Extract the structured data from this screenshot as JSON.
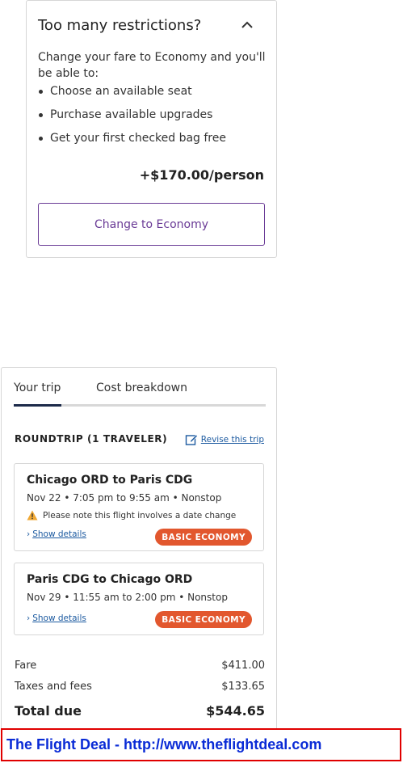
{
  "restrictions": {
    "title": "Too many restrictions?",
    "description": "Change your fare to Economy and you'll be able to:",
    "benefits": [
      "Choose an available seat",
      "Purchase available upgrades",
      "Get your first checked bag free"
    ],
    "price": "+$170.00/person",
    "button_label": "Change to Economy"
  },
  "trip": {
    "tabs": [
      {
        "label": "Your trip",
        "active": true
      },
      {
        "label": "Cost breakdown",
        "active": false
      }
    ],
    "roundtrip_label": "ROUNDTRIP (1 TRAVELER)",
    "revise_label": "Revise this trip",
    "segments": [
      {
        "route": "Chicago ORD to Paris CDG",
        "time": "Nov 22 • 7:05 pm to 9:55 am • Nonstop",
        "warning": "Please note this flight involves a date change",
        "details_label": "Show details",
        "badge": "BASIC ECONOMY"
      },
      {
        "route": "Paris CDG to Chicago ORD",
        "time": "Nov 29 • 11:55 am to 2:00 pm • Nonstop",
        "details_label": "Show details",
        "badge": "BASIC ECONOMY"
      }
    ],
    "costs": [
      {
        "label": "Fare",
        "value": "$411.00"
      },
      {
        "label": "Taxes and fees",
        "value": "$133.65"
      }
    ],
    "total": {
      "label": "Total due",
      "value": "$544.65"
    }
  },
  "banner": {
    "text": "The Flight Deal - http://www.theflightdeal.com"
  },
  "colors": {
    "accent_purple": "#6a3b96",
    "link_blue": "#1c5aa0",
    "badge_orange": "#e2572e",
    "tab_active": "#1d2b4a",
    "banner_border": "#e00000",
    "banner_text": "#0a2bd6"
  },
  "icons": {
    "collapse": "chevron-up-icon",
    "revise": "edit-icon",
    "warning": "warning-icon",
    "details": "chevron-right-icon"
  }
}
